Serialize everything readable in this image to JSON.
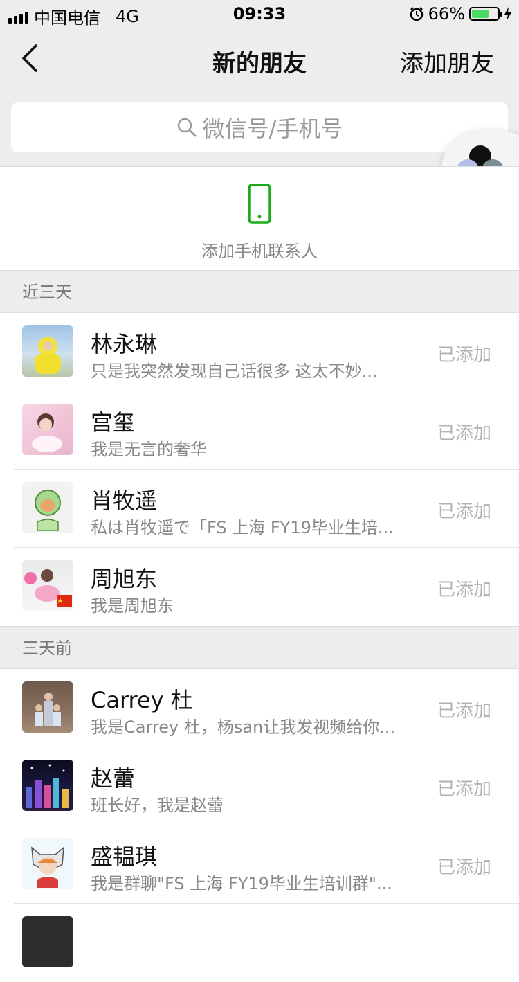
{
  "status_bar": {
    "carrier": "中国电信",
    "network": "4G",
    "time": "09:33",
    "battery": "66%",
    "battery_level": 0.66,
    "accent": "#4cd964"
  },
  "nav": {
    "title": "新的朋友",
    "right_action": "添加朋友",
    "back_icon": "chevron-left-icon"
  },
  "search": {
    "placeholder": "微信号/手机号",
    "icon": "search-icon"
  },
  "add_phone": {
    "label": "添加手机联系人",
    "icon": "phone-icon",
    "color": "#1aad19"
  },
  "sections": [
    {
      "title": "近三天",
      "items": [
        {
          "name": "林永琳",
          "message": "只是我突然发现自己话很多 这太不妙...",
          "status": "已添加"
        },
        {
          "name": "宫玺",
          "message": "我是无言的奢华",
          "status": "已添加"
        },
        {
          "name": "肖牧遥",
          "message": "私は肖牧遥で「FS 上海 FY19毕业生培...",
          "status": "已添加"
        },
        {
          "name": "周旭东",
          "message": "我是周旭东",
          "status": "已添加"
        }
      ]
    },
    {
      "title": "三天前",
      "items": [
        {
          "name": "Carrey 杜",
          "message": "我是Carrey 杜，杨san让我发视频给你...",
          "status": "已添加"
        },
        {
          "name": "赵蕾",
          "message": "班长好，我是赵蕾",
          "status": "已添加"
        },
        {
          "name": "盛韫琪",
          "message": "我是群聊\"FS 上海 FY19毕业生培训群\"...",
          "status": "已添加"
        }
      ]
    }
  ]
}
